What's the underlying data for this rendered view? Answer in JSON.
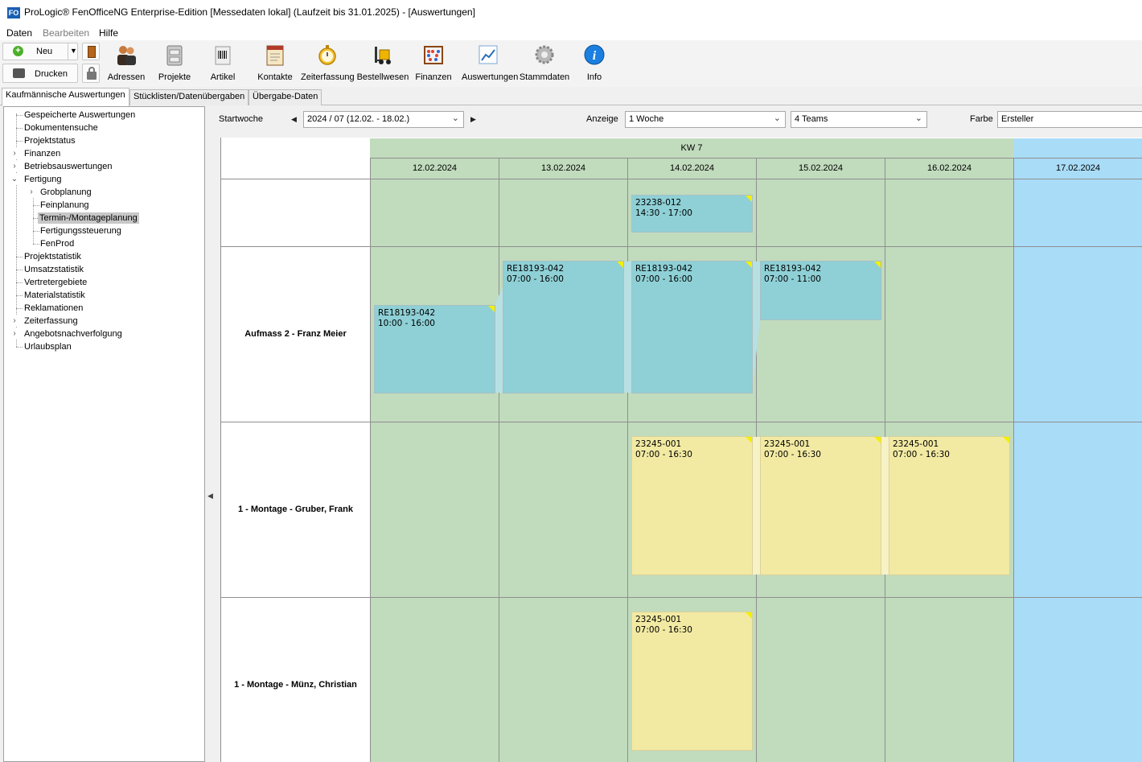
{
  "window": {
    "app_icon_text": "FO",
    "title": "ProLogic® FenOfficeNG Enterprise-Edition [Messedaten lokal] (Laufzeit bis 31.01.2025) - [Auswertungen]"
  },
  "menu": {
    "daten": "Daten",
    "bearbeiten": "Bearbeiten",
    "hilfe": "Hilfe"
  },
  "toolbar": {
    "neu": "Neu",
    "drucken": "Drucken",
    "buttons": [
      "Adressen",
      "Projekte",
      "Artikel",
      "Kontakte",
      "Zeiterfassung",
      "Bestellwesen",
      "Finanzen",
      "Auswertungen",
      "Stammdaten",
      "Info"
    ]
  },
  "tabs": [
    "Kaufmännische Auswertungen",
    "Stücklisten/Datenübergaben",
    "Übergabe-Daten"
  ],
  "tree": [
    "Gespeicherte Auswertungen",
    "Dokumentensuche",
    "Projektstatus",
    "Finanzen",
    "Betriebsauswertungen",
    "Fertigung",
    "Grobplanung",
    "Feinplanung",
    "Termin-/Montageplanung",
    "Fertigungssteuerung",
    "FenProd",
    "Projektstatistik",
    "Umsatzstatistik",
    "Vertretergebiete",
    "Materialstatistik",
    "Reklamationen",
    "Zeiterfassung",
    "Angebotsnachverfolgung",
    "Urlaubsplan"
  ],
  "filters": {
    "startwoche_label": "Startwoche",
    "startwoche_value": "2024 / 07 (12.02. - 18.02.)",
    "anzeige_label": "Anzeige",
    "anzeige_value": "1 Woche",
    "teams_value": "4 Teams",
    "farbe_label": "Farbe",
    "farbe_value": "Ersteller"
  },
  "planner": {
    "week_label": "KW 7",
    "days": [
      "12.02.2024",
      "13.02.2024",
      "14.02.2024",
      "15.02.2024",
      "16.02.2024",
      "17.02.2024"
    ],
    "rows": [
      "",
      "Aufmass 2 - Franz Meier",
      "1 - Montage - Gruber, Frank",
      "1 - Montage - Münz, Christian"
    ],
    "appointments": [
      {
        "id": "23238-012",
        "time": "14:30 - 17:00",
        "color": "#8ed0d6"
      },
      {
        "id": "RE18193-042",
        "time": "10:00 - 16:00",
        "color": "#8ed0d6"
      },
      {
        "id": "RE18193-042",
        "time": "07:00 - 16:00",
        "color": "#8ed0d6"
      },
      {
        "id": "RE18193-042",
        "time": "07:00 - 16:00",
        "color": "#8ed0d6"
      },
      {
        "id": "RE18193-042",
        "time": "07:00 - 11:00",
        "color": "#8ed0d6"
      },
      {
        "id": "23245-001",
        "time": "07:00 - 16:30",
        "color": "#f2eaa3"
      },
      {
        "id": "23245-001",
        "time": "07:00 - 16:30",
        "color": "#f2eaa3"
      },
      {
        "id": "23245-001",
        "time": "07:00 - 16:30",
        "color": "#f2eaa3"
      },
      {
        "id": "23245-001",
        "time": "07:00 - 16:30",
        "color": "#f2eaa3"
      }
    ]
  }
}
